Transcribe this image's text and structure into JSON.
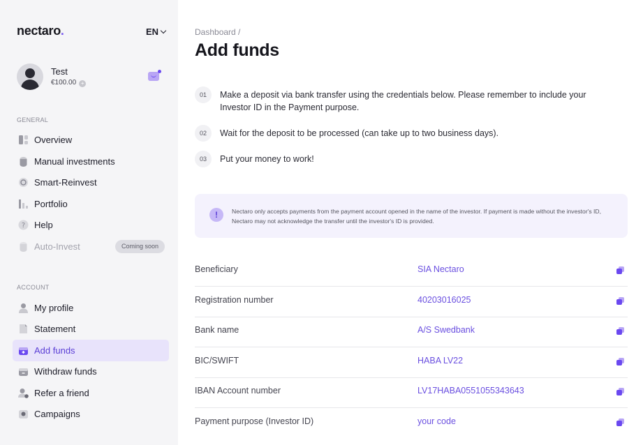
{
  "brand": {
    "logo_text": "nectaro",
    "logo_dot": "."
  },
  "header": {
    "language": "EN"
  },
  "user": {
    "name": "Test",
    "balance": "€100.00"
  },
  "sidebar": {
    "general_label": "GENERAL",
    "general_items": [
      {
        "label": "Overview"
      },
      {
        "label": "Manual investments"
      },
      {
        "label": "Smart-Reinvest"
      },
      {
        "label": "Portfolio"
      },
      {
        "label": "Help"
      },
      {
        "label": "Auto-Invest",
        "badge": "Coming soon"
      }
    ],
    "account_label": "ACCOUNT",
    "account_items": [
      {
        "label": "My profile"
      },
      {
        "label": "Statement"
      },
      {
        "label": "Add funds"
      },
      {
        "label": "Withdraw funds"
      },
      {
        "label": "Refer a friend"
      },
      {
        "label": "Campaigns"
      }
    ]
  },
  "main": {
    "breadcrumb": "Dashboard /",
    "title": "Add funds",
    "steps": [
      {
        "num": "01",
        "text": "Make a deposit via bank transfer using the credentials below. Please remember to include your Investor ID in the Payment purpose."
      },
      {
        "num": "02",
        "text": "Wait for the deposit to be processed (can take up to two business days)."
      },
      {
        "num": "03",
        "text": "Put your money to work!"
      }
    ],
    "notice": "Nectaro only accepts payments from the payment account opened in the name of the investor. If payment is made without the investor's ID, Nectaro may not acknowledge the transfer until the investor's ID is provided.",
    "bank_details": [
      {
        "label": "Beneficiary",
        "value": "SIA Nectaro"
      },
      {
        "label": "Registration number",
        "value": "40203016025"
      },
      {
        "label": "Bank name",
        "value": "A/S Swedbank"
      },
      {
        "label": "BIC/SWIFT",
        "value": "HABA LV22"
      },
      {
        "label": "IBAN Account number",
        "value": "LV17HABA0551055343643"
      },
      {
        "label": "Payment purpose (Investor ID)",
        "value": "your code"
      }
    ]
  },
  "colors": {
    "accent": "#6a4fe0",
    "active_bg": "#e8e3fb",
    "sidebar_bg": "#f5f5f7"
  }
}
